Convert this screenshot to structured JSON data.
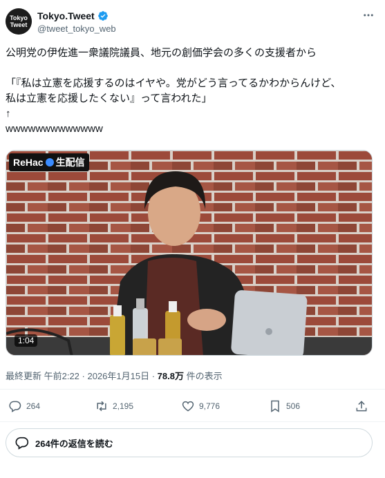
{
  "account": {
    "display_name": "Tokyo.Tweet",
    "handle": "@tweet_tokyo_web",
    "avatar_text_line1": "Tokyo",
    "avatar_text_line2": "Tweet"
  },
  "tweet": {
    "line1": "公明党の伊佐進一衆議院議員、地元の創価学会の多くの支援者から",
    "line2": "「『私は立憲を応援するのはイヤや。党がどう言ってるかわからんけど、",
    "line3": "私は立憲を応援したくない』って言われた」",
    "line4": "↑",
    "line5": "wwwwwwwwwwwww"
  },
  "media": {
    "badge_text": "ReHac",
    "badge_suffix": "生配信",
    "duration": "1:04"
  },
  "meta": {
    "timestamp": "最終更新 午前2:22 · 2026年1月15日 · ",
    "views_count": "78.8万",
    "views_label": " 件の表示"
  },
  "actions": {
    "reply_count": "264",
    "retweet_count": "2,195",
    "like_count": "9,776",
    "bookmark_count": "506"
  },
  "replies": {
    "label": "264件の返信を読む"
  },
  "colors": {
    "verified": "#1d9bf0",
    "text_secondary": "#536471",
    "border": "#cfd9de"
  }
}
